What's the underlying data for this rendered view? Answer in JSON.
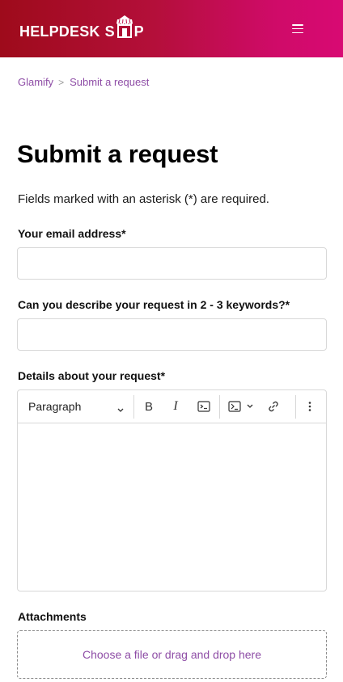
{
  "header": {
    "logo_left": "HELPDESK",
    "logo_shop_s": "S",
    "logo_shop_rest": "P",
    "logo_alt": "HELPDESK SHOP",
    "menu_icon": "hamburger-menu-icon",
    "colors": {
      "gradient_start": "#9e0b1b",
      "gradient_end": "#d80a73"
    }
  },
  "breadcrumb": {
    "items": [
      "Glamify",
      "Submit a request"
    ],
    "separator": ">",
    "link_color": "#8e4da6"
  },
  "page": {
    "title": "Submit a request",
    "note": "Fields marked with an asterisk (*) are required."
  },
  "form": {
    "email": {
      "label": "Your email address*",
      "value": ""
    },
    "keywords": {
      "label": "Can you describe your request in 2 - 3 keywords?*",
      "value": ""
    },
    "details": {
      "label": "Details about your request*",
      "toolbar": {
        "block_format": "Paragraph",
        "icons": [
          "chevron-down-icon",
          "bold-icon",
          "italic-icon",
          "code-icon",
          "code-block-icon",
          "chevron-down-icon",
          "link-icon",
          "more-options-icon"
        ],
        "bold_glyph": "B",
        "italic_glyph": "I"
      },
      "value": ""
    },
    "attachments": {
      "label": "Attachments",
      "dropzone_text": "Choose a file or drag and drop here"
    }
  }
}
